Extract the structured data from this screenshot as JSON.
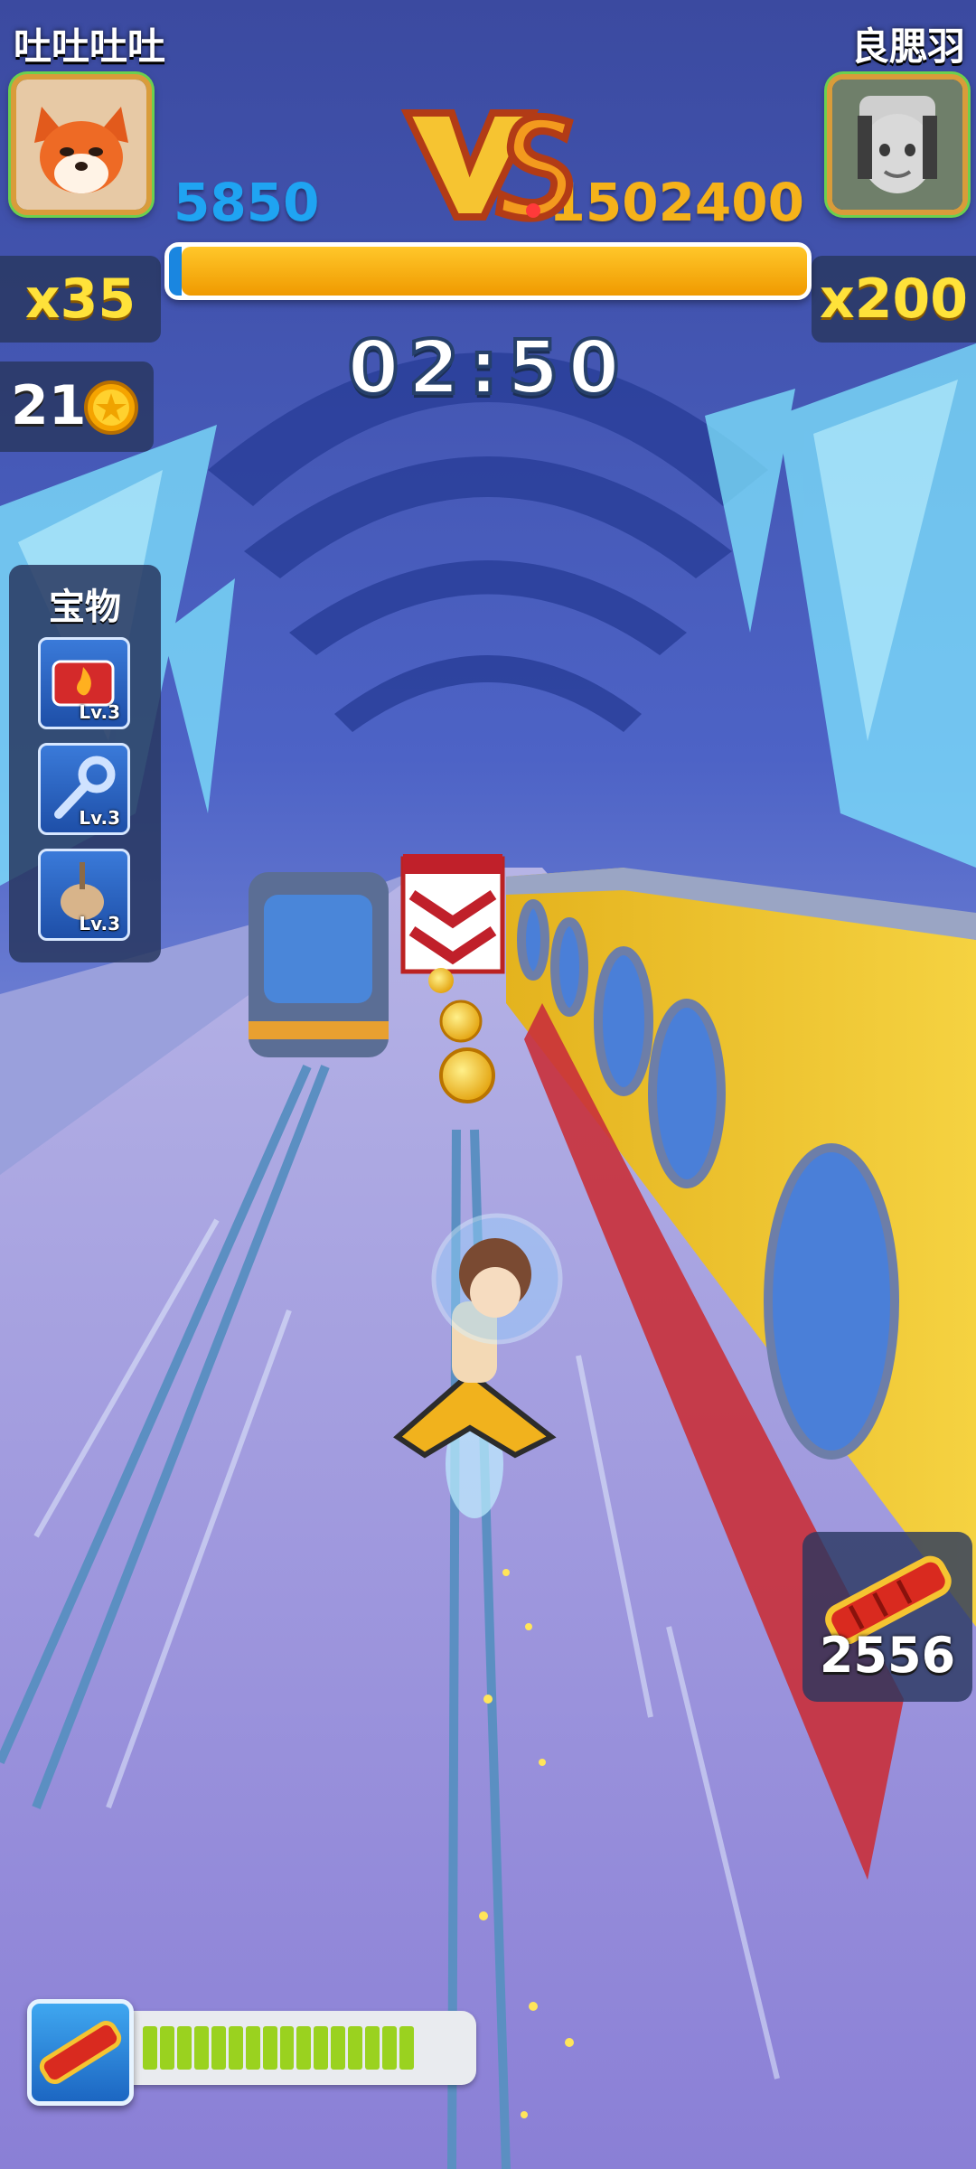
{
  "players": {
    "left": {
      "name": "吐吐吐吐",
      "score": "5850",
      "multiplier": "x35",
      "color": "#1fa4f2"
    },
    "right": {
      "name": "良腮羽",
      "score": "1502400",
      "multiplier": "x200",
      "color": "#f5b21a"
    }
  },
  "vs_label": "VS",
  "progress": {
    "right_share": 0.98
  },
  "timer": "02:50",
  "coins": {
    "count": "21",
    "icon": "coin-icon"
  },
  "treasure": {
    "title": "宝物",
    "items": [
      {
        "name": "fire-treasure-icon",
        "level": "Lv.3"
      },
      {
        "name": "magnet-key-treasure-icon",
        "level": "Lv.3"
      },
      {
        "name": "pin-treasure-icon",
        "level": "Lv.3"
      }
    ]
  },
  "hoverboard": {
    "count": "2556",
    "icon": "hoverboard-icon"
  },
  "booster": {
    "icon": "hoverboard-icon",
    "segments_filled": 16,
    "segments_total": 16
  }
}
